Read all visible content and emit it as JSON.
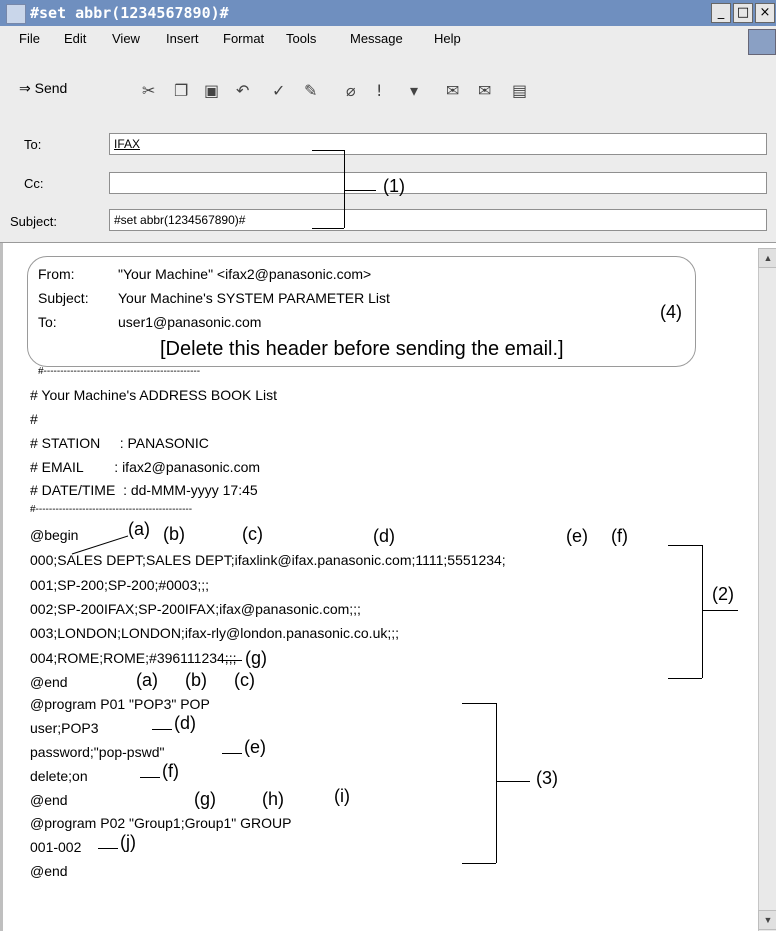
{
  "window": {
    "title": "#set abbr(1234567890)#",
    "buttons": [
      "_",
      "□",
      "×"
    ]
  },
  "menu": [
    "File",
    "Edit",
    "View",
    "Insert",
    "Format",
    "Tools",
    "Message",
    "Help"
  ],
  "toolbar": {
    "send_label": "Send",
    "icons": [
      "cut-icon",
      "copy-icon",
      "paste-icon",
      "undo-icon",
      "check-names-icon",
      "spelling-icon",
      "attach-icon",
      "priority-icon",
      "sign-icon",
      "encrypt-icon",
      "offline-icon"
    ]
  },
  "fields": {
    "to_label": "To:",
    "to_value": "IFAX",
    "cc_label": "Cc:",
    "cc_value": "",
    "subject_label": "Subject:",
    "subject_value": "#set abbr(1234567890)#"
  },
  "callouts": {
    "c1": "(1)",
    "c2": "(2)",
    "c3": "(3)",
    "c4": "(4)"
  },
  "header_box": {
    "from_label": "From:",
    "from_value": "\"Your Machine\" <ifax2@panasonic.com>",
    "subject_label": "Subject:",
    "subject_value": "Your Machine's SYSTEM PARAMETER List",
    "to_label": "To:",
    "to_value": "user1@panasonic.com",
    "note": "[Delete this header before sending the email.]"
  },
  "body": {
    "sep1": "#-----------------------------------------------",
    "line1": "# Your Machine's ADDRESS BOOK List",
    "line2": "#",
    "line3": "# STATION     : PANASONIC",
    "line4": "# EMAIL        : ifax2@panasonic.com",
    "line5": "# DATE/TIME  : dd-MMM-yyyy 17:45",
    "sep2": "#-----------------------------------------------",
    "begin": "@begin",
    "r0": "000;SALES DEPT;SALES DEPT;ifaxlink@ifax.panasonic.com;1111;5551234;",
    "r1": "001;SP-200;SP-200;#0003;;;",
    "r2": "002;SP-200IFAX;SP-200IFAX;ifax@panasonic.com;;;",
    "r3": "003;LONDON;LONDON;ifax-rly@london.panasonic.co.uk;;;",
    "r4": "004;ROME;ROME;#396111234;;;",
    "end1": "@end",
    "prog1": "@program P01 \"POP3\" POP",
    "user": "user;POP3",
    "password": "password;\"pop-pswd\"",
    "delete": "delete;on",
    "end2": "@end",
    "prog2": "@program P02 \"Group1;Group1\" GROUP",
    "group": "001-002",
    "end3": "@end"
  },
  "labels": {
    "a": "(a)",
    "b": "(b)",
    "c": "(c)",
    "d": "(d)",
    "e": "(e)",
    "f": "(f)",
    "g": "(g)",
    "h": "(h)",
    "i": "(i)",
    "j": "(j)"
  }
}
